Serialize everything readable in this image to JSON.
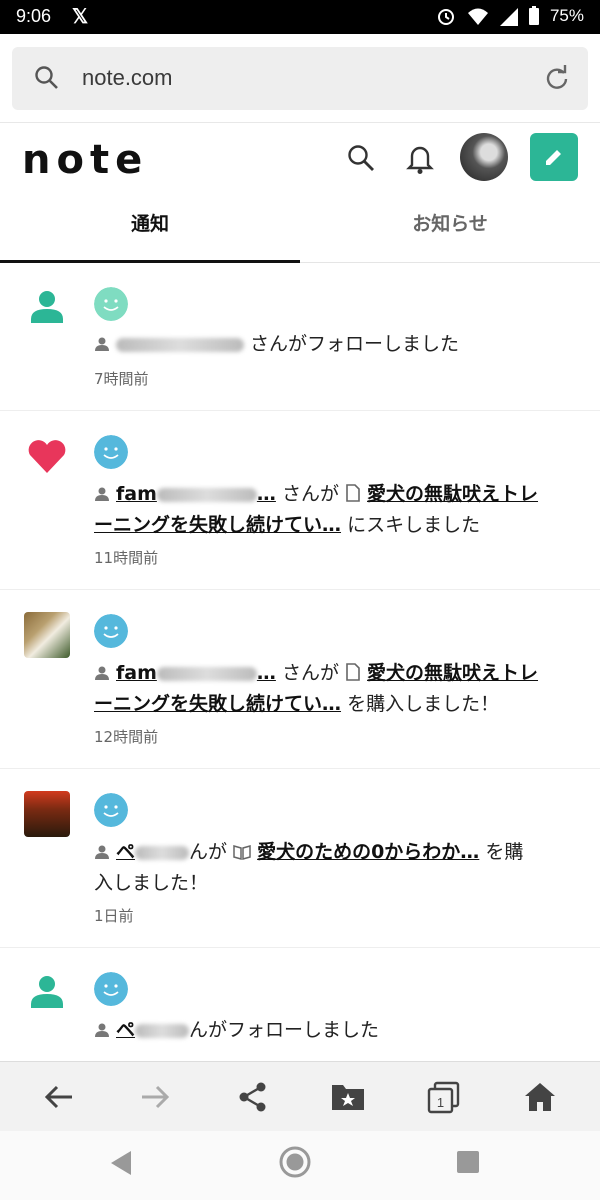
{
  "status": {
    "time": "9:06",
    "battery": "75%",
    "x_logo": "𝕏"
  },
  "browser": {
    "url": "note.com"
  },
  "header": {
    "logo": "note"
  },
  "tabs": [
    {
      "label": "通知"
    },
    {
      "label": "お知らせ"
    }
  ],
  "notifications": [
    {
      "icon": "person-icon",
      "line1_pre": "",
      "line1_name": "",
      "line1_post": "さんがフォローしました",
      "time": "7時間前"
    },
    {
      "icon": "heart-icon",
      "name_prefix": "fam",
      "after_name": "さんが",
      "article": "愛犬の無駄吠えトレ",
      "article2": "ーニングを失敗し続けてい…",
      "action": "にスキしました",
      "time": "11時間前"
    },
    {
      "icon": "dog-thumb",
      "name_prefix": "fam",
      "after_name": "さんが",
      "article": "愛犬の無駄吠えトレ",
      "article2": "ーニングを失敗し続けてい…",
      "action": "を購入しました！",
      "time": "12時間前"
    },
    {
      "icon": "event-thumb",
      "name_prefix": "ペ",
      "after_name": "んが",
      "magazine": "愛犬のための0からわか…",
      "action": "を購",
      "action2": "入しました！",
      "time": "1日前"
    },
    {
      "icon": "person-icon",
      "name_prefix": "ペ",
      "after_name": "んがフォローしました"
    }
  ],
  "colors": {
    "accent": "#2cb696",
    "heart": "#e8365b",
    "smiley_teal": "#7fdcc1",
    "smiley_blue": "#55b8dc"
  }
}
